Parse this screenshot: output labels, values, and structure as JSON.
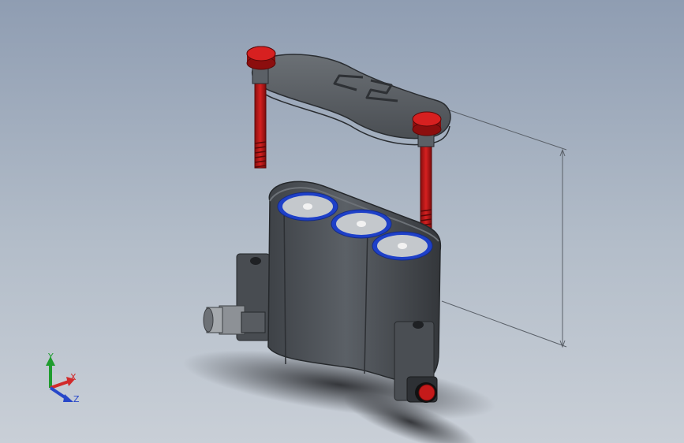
{
  "triad": {
    "y_label": "Y",
    "x_label": "X",
    "z_label": "Z",
    "colors": {
      "y": "#1f9c2e",
      "x": "#d22a2a",
      "z": "#2747c9"
    }
  },
  "colors": {
    "background_top": "#8f9db2",
    "background_bottom": "#c9cfd7",
    "body_gray": "#4a4e53",
    "screw_red": "#c51a1a",
    "battery_blue": "#1e40c8",
    "battery_top": "#c4c8cc"
  },
  "model": {
    "lid_logo": "CS"
  }
}
